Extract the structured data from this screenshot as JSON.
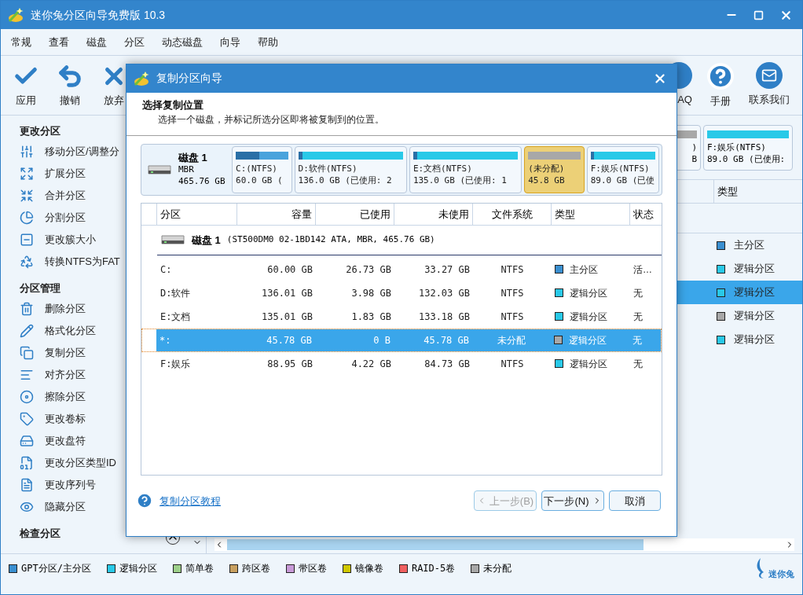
{
  "window": {
    "title": "迷你兔分区向导免费版 10.3"
  },
  "menu": [
    "常规",
    "查看",
    "磁盘",
    "分区",
    "动态磁盘",
    "向导",
    "帮助"
  ],
  "toolbar_left": [
    {
      "kind": "apply",
      "label": "应用"
    },
    {
      "kind": "undo",
      "label": "撤销"
    },
    {
      "kind": "discard",
      "label": "放弃"
    }
  ],
  "toolbar_right": [
    {
      "kind": "faq",
      "label": "AQ"
    },
    {
      "kind": "manual",
      "label": "手册"
    },
    {
      "kind": "contact",
      "label": "联系我们"
    }
  ],
  "sidebar": {
    "sections": [
      {
        "title": "更改分区",
        "items": [
          {
            "kind": "move",
            "label": "移动分区/调整分"
          },
          {
            "kind": "extend",
            "label": "扩展分区"
          },
          {
            "kind": "merge",
            "label": "合并分区"
          },
          {
            "kind": "split",
            "label": "分割分区"
          },
          {
            "kind": "cluster",
            "label": "更改簇大小"
          },
          {
            "kind": "convert",
            "label": "转换NTFS为FAT"
          }
        ]
      },
      {
        "title": "分区管理",
        "items": [
          {
            "kind": "delete",
            "label": "删除分区"
          },
          {
            "kind": "format",
            "label": "格式化分区"
          },
          {
            "kind": "copy",
            "label": "复制分区"
          },
          {
            "kind": "align",
            "label": "对齐分区"
          },
          {
            "kind": "wipe",
            "label": "擦除分区"
          },
          {
            "kind": "label",
            "label": "更改卷标"
          },
          {
            "kind": "letter",
            "label": "更改盘符"
          },
          {
            "kind": "typeid",
            "label": "更改分区类型ID"
          },
          {
            "kind": "serial",
            "label": "更改序列号"
          },
          {
            "kind": "hide",
            "label": "隐藏分区"
          }
        ]
      },
      {
        "title": "检查分区"
      }
    ]
  },
  "background_disk_cards": [
    {
      "line1": ")",
      "line2": "B",
      "color": "#a8a8a8"
    },
    {
      "line1": "F:娱乐(NTFS)",
      "line2": "89.0 GB (已使用:",
      "color": "#29c9e8"
    }
  ],
  "background_table": {
    "column": "类型",
    "rows": [
      {
        "type": "主分区",
        "color": "#3a8fd0",
        "selected": false
      },
      {
        "type": "逻辑分区",
        "color": "#29c9e8",
        "selected": false
      },
      {
        "type": "逻辑分区",
        "color": "#29c9e8",
        "selected": true
      },
      {
        "type": "逻辑分区",
        "color": "#a8a8a8",
        "selected": false
      },
      {
        "type": "逻辑分区",
        "color": "#29c9e8",
        "selected": false
      }
    ]
  },
  "legend": [
    {
      "label": "GPT分区/主分区",
      "color": "#3a8fd0"
    },
    {
      "label": "逻辑分区",
      "color": "#29c9e8"
    },
    {
      "label": "简单卷",
      "color": "#9ed08a"
    },
    {
      "label": "跨区卷",
      "color": "#c8a060"
    },
    {
      "label": "带区卷",
      "color": "#c89ad8"
    },
    {
      "label": "镜像卷",
      "color": "#d0c800"
    },
    {
      "label": "RAID-5卷",
      "color": "#f06060"
    },
    {
      "label": "未分配",
      "color": "#a8a8a8"
    }
  ],
  "logo": "迷你兔",
  "dialog": {
    "title": "复制分区向导",
    "heading": "选择复制位置",
    "subtitle": "选择一个磁盘，并标记所选分区即将被复制到的位置。",
    "disk": {
      "name": "磁盘 1",
      "scheme": "MBR",
      "size": "465.76 GB",
      "partitions": [
        {
          "line1": "C:(NTFS)",
          "line2": "60.0 GB (",
          "color": "#4aa3dc",
          "level": 0.45,
          "selected": false
        },
        {
          "line1": "D:软件(NTFS)",
          "line2": "136.0 GB (已使用: 2",
          "color": "#29c9e8",
          "level": 0.03,
          "selected": false
        },
        {
          "line1": "E:文档(NTFS)",
          "line2": "135.0 GB (已使用: 1",
          "color": "#29c9e8",
          "level": 0.014,
          "selected": false
        },
        {
          "line1": "(未分配)",
          "line2": "45.8 GB",
          "color": "#a8a8a8",
          "selected": true
        },
        {
          "line1": "F:娱乐(NTFS)",
          "line2": "89.0 GB (已使",
          "color": "#29c9e8",
          "level": 0.047,
          "selected": false
        }
      ]
    },
    "table": {
      "columns": [
        "分区",
        "容量",
        "已使用",
        "未使用",
        "文件系统",
        "类型",
        "状态"
      ],
      "disk_row": {
        "name": "磁盘 1",
        "detail": "(ST500DM0 02-1BD142 ATA, MBR, 465.76 GB)"
      },
      "rows": [
        {
          "partition": "C:",
          "capacity": "60.00 GB",
          "used": "26.73 GB",
          "unused": "33.27 GB",
          "fs": "NTFS",
          "type": "主分区",
          "color": "#3a8fd0",
          "status": "活…",
          "selected": false
        },
        {
          "partition": "D:软件",
          "capacity": "136.01 GB",
          "used": "3.98 GB",
          "unused": "132.03 GB",
          "fs": "NTFS",
          "type": "逻辑分区",
          "color": "#29c9e8",
          "status": "无",
          "selected": false
        },
        {
          "partition": "E:文档",
          "capacity": "135.01 GB",
          "used": "1.83 GB",
          "unused": "133.18 GB",
          "fs": "NTFS",
          "type": "逻辑分区",
          "color": "#29c9e8",
          "status": "无",
          "selected": false
        },
        {
          "partition": "*:",
          "capacity": "45.78 GB",
          "used": "0 B",
          "unused": "45.78 GB",
          "fs": "未分配",
          "type": "逻辑分区",
          "color": "#a8a8a8",
          "status": "无",
          "selected": true
        },
        {
          "partition": "F:娱乐",
          "capacity": "88.95 GB",
          "used": "4.22 GB",
          "unused": "84.73 GB",
          "fs": "NTFS",
          "type": "逻辑分区",
          "color": "#29c9e8",
          "status": "无",
          "selected": false
        }
      ]
    },
    "help_link": "复制分区教程",
    "buttons": [
      {
        "kind": "back",
        "label": "上一步(B)",
        "disabled": true
      },
      {
        "kind": "next",
        "label": "下一步(N)",
        "disabled": false
      },
      {
        "kind": "cancel",
        "label": "取消",
        "disabled": false
      }
    ]
  }
}
